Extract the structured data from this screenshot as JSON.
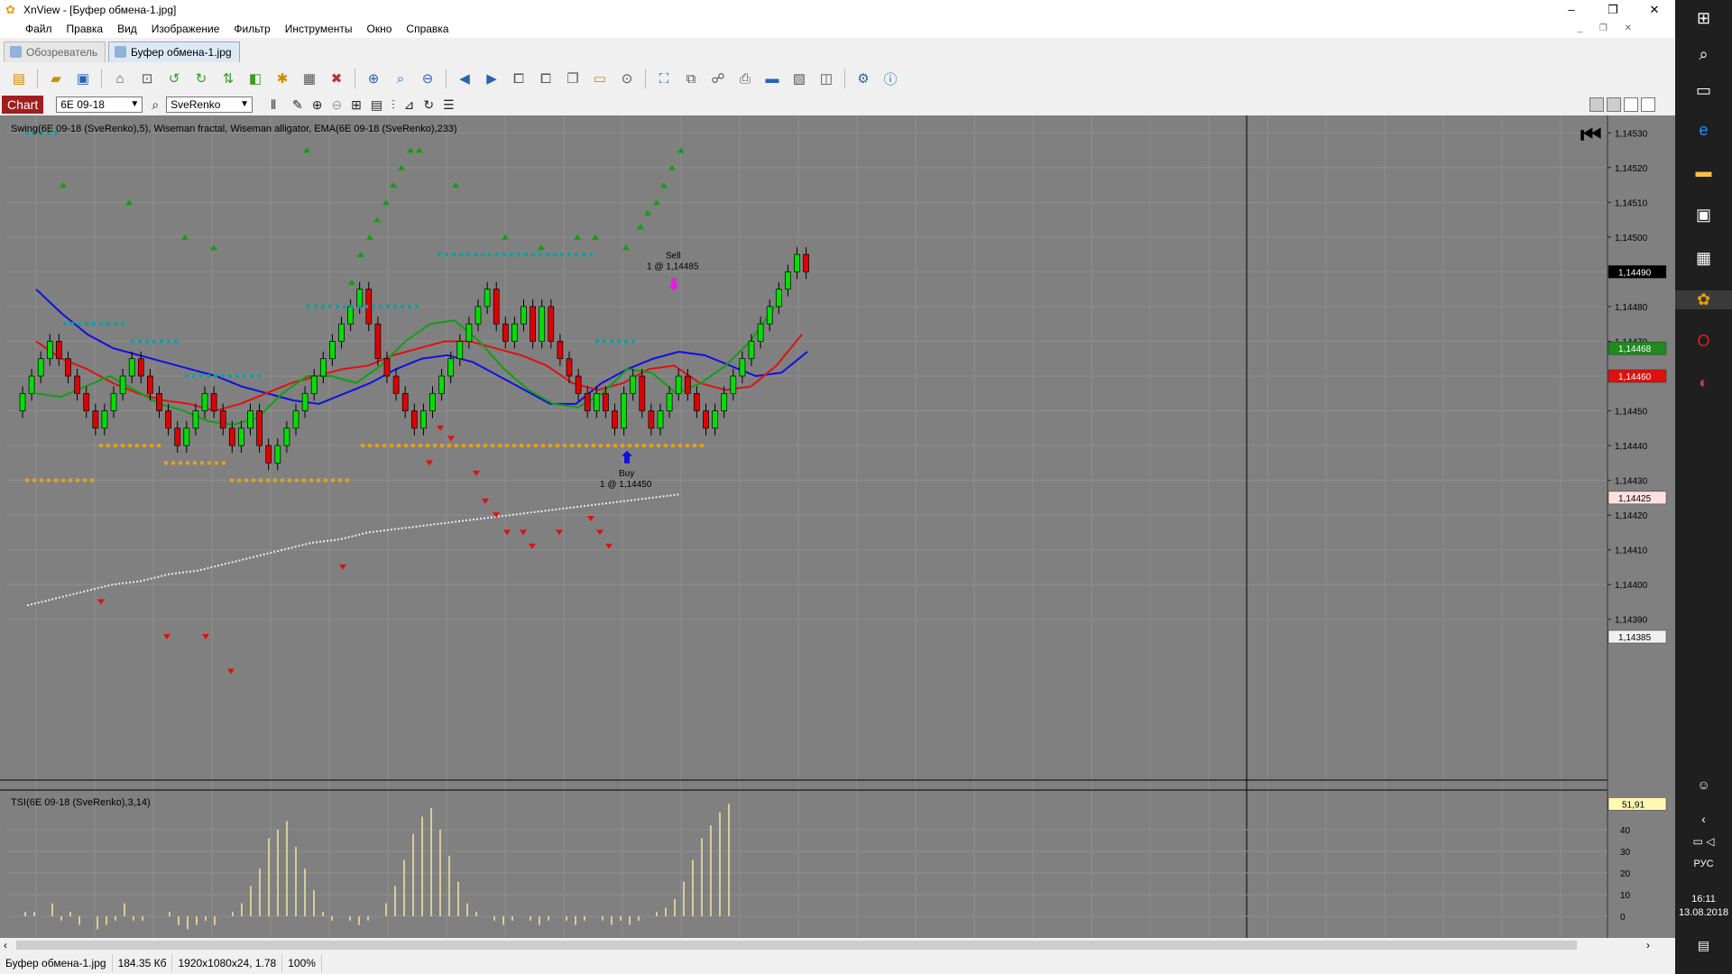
{
  "window": {
    "title": "XnView - [Буфер обмена-1.jpg]",
    "controls": [
      "–",
      "❐",
      "✕"
    ]
  },
  "menu": [
    "Файл",
    "Правка",
    "Вид",
    "Изображение",
    "Фильтр",
    "Инструменты",
    "Окно",
    "Справка"
  ],
  "tabs": [
    {
      "label": "Обозреватель",
      "active": false
    },
    {
      "label": "Буфер обмена-1.jpg",
      "active": true
    }
  ],
  "chart_toolbar": {
    "chart_label": "Chart",
    "instrument": "6E 09-18",
    "bar_type": "SveRenko"
  },
  "statusbar": {
    "filename": "Буфер обмена-1.jpg",
    "filesize": "184.35 Кб",
    "dimensions": "1920x1080x24, 1.78",
    "zoom": "100%"
  },
  "taskbar": {
    "language": "РУС",
    "time": "16:11",
    "date": "13.08.2018"
  },
  "chart_data": [
    {
      "type": "candlestick",
      "title": "Swing(6E 09-18 (SveRenko),5), Wiseman fractal, Wiseman alligator, EMA(6E 09-18 (SveRenko),233)",
      "ylim": [
        1.14385,
        1.14535
      ],
      "y_ticks": [
        "1,14530",
        "1,14520",
        "1,14510",
        "1,14500",
        "1,14490",
        "1,14480",
        "1,14470",
        "1,14460",
        "1,14450",
        "1,14440",
        "1,14430",
        "1,14420",
        "1,14410",
        "1,14400",
        "1,14390"
      ],
      "price_tags": [
        {
          "label": "1,14490",
          "value": 1.1449,
          "color": "#000000",
          "text_color": "#ffffff"
        },
        {
          "label": "1,14468",
          "value": 1.14468,
          "color": "#1e8c1e",
          "text_color": "#ffffff"
        },
        {
          "label": "1,14460",
          "value": 1.1446,
          "color": "#e01010",
          "text_color": "#ffffff"
        },
        {
          "label": "1,14425",
          "value": 1.14425,
          "color": "#ffe0e0",
          "text_color": "#000000"
        },
        {
          "label": "1,14385",
          "value": 1.14385,
          "color": "#f0f0f0",
          "text_color": "#000000"
        }
      ],
      "candles": [
        {
          "o": 1.1445,
          "c": 1.14455
        },
        {
          "o": 1.14455,
          "c": 1.1446
        },
        {
          "o": 1.1446,
          "c": 1.14465
        },
        {
          "o": 1.14465,
          "c": 1.1447
        },
        {
          "o": 1.1447,
          "c": 1.14465
        },
        {
          "o": 1.14465,
          "c": 1.1446
        },
        {
          "o": 1.1446,
          "c": 1.14455
        },
        {
          "o": 1.14455,
          "c": 1.1445
        },
        {
          "o": 1.1445,
          "c": 1.14445
        },
        {
          "o": 1.14445,
          "c": 1.1445
        },
        {
          "o": 1.1445,
          "c": 1.14455
        },
        {
          "o": 1.14455,
          "c": 1.1446
        },
        {
          "o": 1.1446,
          "c": 1.14465
        },
        {
          "o": 1.14465,
          "c": 1.1446
        },
        {
          "o": 1.1446,
          "c": 1.14455
        },
        {
          "o": 1.14455,
          "c": 1.1445
        },
        {
          "o": 1.1445,
          "c": 1.14445
        },
        {
          "o": 1.14445,
          "c": 1.1444
        },
        {
          "o": 1.1444,
          "c": 1.14445
        },
        {
          "o": 1.14445,
          "c": 1.1445
        },
        {
          "o": 1.1445,
          "c": 1.14455
        },
        {
          "o": 1.14455,
          "c": 1.1445
        },
        {
          "o": 1.1445,
          "c": 1.14445
        },
        {
          "o": 1.14445,
          "c": 1.1444
        },
        {
          "o": 1.1444,
          "c": 1.14445
        },
        {
          "o": 1.14445,
          "c": 1.1445
        },
        {
          "o": 1.1445,
          "c": 1.1444
        },
        {
          "o": 1.1444,
          "c": 1.14435
        },
        {
          "o": 1.14435,
          "c": 1.1444
        },
        {
          "o": 1.1444,
          "c": 1.14445
        },
        {
          "o": 1.14445,
          "c": 1.1445
        },
        {
          "o": 1.1445,
          "c": 1.14455
        },
        {
          "o": 1.14455,
          "c": 1.1446
        },
        {
          "o": 1.1446,
          "c": 1.14465
        },
        {
          "o": 1.14465,
          "c": 1.1447
        },
        {
          "o": 1.1447,
          "c": 1.14475
        },
        {
          "o": 1.14475,
          "c": 1.1448
        },
        {
          "o": 1.1448,
          "c": 1.14485
        },
        {
          "o": 1.14485,
          "c": 1.14475
        },
        {
          "o": 1.14475,
          "c": 1.14465
        },
        {
          "o": 1.14465,
          "c": 1.1446
        },
        {
          "o": 1.1446,
          "c": 1.14455
        },
        {
          "o": 1.14455,
          "c": 1.1445
        },
        {
          "o": 1.1445,
          "c": 1.14445
        },
        {
          "o": 1.14445,
          "c": 1.1445
        },
        {
          "o": 1.1445,
          "c": 1.14455
        },
        {
          "o": 1.14455,
          "c": 1.1446
        },
        {
          "o": 1.1446,
          "c": 1.14465
        },
        {
          "o": 1.14465,
          "c": 1.1447
        },
        {
          "o": 1.1447,
          "c": 1.14475
        },
        {
          "o": 1.14475,
          "c": 1.1448
        },
        {
          "o": 1.1448,
          "c": 1.14485
        },
        {
          "o": 1.14485,
          "c": 1.14475
        },
        {
          "o": 1.14475,
          "c": 1.1447
        },
        {
          "o": 1.1447,
          "c": 1.14475
        },
        {
          "o": 1.14475,
          "c": 1.1448
        },
        {
          "o": 1.1448,
          "c": 1.1447
        },
        {
          "o": 1.1447,
          "c": 1.1448
        },
        {
          "o": 1.1448,
          "c": 1.1447
        },
        {
          "o": 1.1447,
          "c": 1.14465
        },
        {
          "o": 1.14465,
          "c": 1.1446
        },
        {
          "o": 1.1446,
          "c": 1.14455
        },
        {
          "o": 1.14455,
          "c": 1.1445
        },
        {
          "o": 1.1445,
          "c": 1.14455
        },
        {
          "o": 1.14455,
          "c": 1.1445
        },
        {
          "o": 1.1445,
          "c": 1.14445
        },
        {
          "o": 1.14445,
          "c": 1.14455
        },
        {
          "o": 1.14455,
          "c": 1.1446
        },
        {
          "o": 1.1446,
          "c": 1.1445
        },
        {
          "o": 1.1445,
          "c": 1.14445
        },
        {
          "o": 1.14445,
          "c": 1.1445
        },
        {
          "o": 1.1445,
          "c": 1.14455
        },
        {
          "o": 1.14455,
          "c": 1.1446
        },
        {
          "o": 1.1446,
          "c": 1.14455
        },
        {
          "o": 1.14455,
          "c": 1.1445
        },
        {
          "o": 1.1445,
          "c": 1.14445
        },
        {
          "o": 1.14445,
          "c": 1.1445
        },
        {
          "o": 1.1445,
          "c": 1.14455
        },
        {
          "o": 1.14455,
          "c": 1.1446
        },
        {
          "o": 1.1446,
          "c": 1.14465
        },
        {
          "o": 1.14465,
          "c": 1.1447
        },
        {
          "o": 1.1447,
          "c": 1.14475
        },
        {
          "o": 1.14475,
          "c": 1.1448
        },
        {
          "o": 1.1448,
          "c": 1.14485
        },
        {
          "o": 1.14485,
          "c": 1.1449
        },
        {
          "o": 1.1449,
          "c": 1.14495
        },
        {
          "o": 1.14495,
          "c": 1.1449
        }
      ],
      "alligator_blue": [
        1.14485,
        1.14478,
        1.14472,
        1.14468,
        1.14466,
        1.14464,
        1.14462,
        1.1446,
        1.14457,
        1.14455,
        1.14453,
        1.14452,
        1.14455,
        1.14458,
        1.14462,
        1.14465,
        1.14466,
        1.14464,
        1.1446,
        1.14456,
        1.14452,
        1.14452,
        1.14458,
        1.14462,
        1.14465,
        1.14467,
        1.14466,
        1.14463,
        1.1446,
        1.14461,
        1.14467
      ],
      "alligator_red": [
        1.1447,
        1.14465,
        1.14462,
        1.14458,
        1.14455,
        1.14453,
        1.14452,
        1.1445,
        1.14452,
        1.14455,
        1.14458,
        1.1446,
        1.14462,
        1.14463,
        1.14466,
        1.14468,
        1.1447,
        1.1447,
        1.14468,
        1.14466,
        1.14463,
        1.14458,
        1.14456,
        1.14458,
        1.14462,
        1.14463,
        1.14458,
        1.14456,
        1.14457,
        1.14463,
        1.14472
      ],
      "alligator_green": [
        1.14455,
        1.14454,
        1.14457,
        1.1446,
        1.14456,
        1.14452,
        1.1445,
        1.14447,
        1.14446,
        1.14448,
        1.14455,
        1.1446,
        1.1446,
        1.14458,
        1.14463,
        1.1447,
        1.14475,
        1.14476,
        1.1447,
        1.14462,
        1.14456,
        1.14452,
        1.14451,
        1.14455,
        1.14462,
        1.14461,
        1.14455,
        1.14458,
        1.14463,
        1.1447,
        1.1448
      ],
      "ema_233": [
        1.14394,
        1.14396,
        1.14398,
        1.144,
        1.14401,
        1.14403,
        1.14404,
        1.14406,
        1.14408,
        1.1441,
        1.14412,
        1.14413,
        1.14415,
        1.14416,
        1.14417,
        1.14418,
        1.14419,
        1.1442,
        1.14421,
        1.14422,
        1.14423,
        1.14424,
        1.14425,
        1.14426
      ],
      "trades": [
        {
          "side": "Sell",
          "label": "Sell",
          "qty_price": "1 @ 1,14485"
        },
        {
          "side": "Buy",
          "label": "Buy",
          "qty_price": "1 @ 1,14450"
        }
      ]
    },
    {
      "type": "bar",
      "title": "TSI(6E 09-18 (SveRenko),3,14)",
      "current_value": "51,91",
      "y_ticks": [
        "40",
        "30",
        "20",
        "10",
        "0"
      ],
      "values": [
        2,
        2,
        0,
        6,
        -2,
        2,
        -4,
        0,
        -6,
        -4,
        -2,
        6,
        -2,
        -2,
        0,
        0,
        2,
        -4,
        -6,
        -4,
        -2,
        -4,
        0,
        2,
        6,
        14,
        22,
        36,
        40,
        44,
        32,
        22,
        12,
        2,
        -2,
        0,
        -2,
        -4,
        -2,
        0,
        6,
        14,
        26,
        38,
        46,
        50,
        40,
        28,
        16,
        6,
        2,
        0,
        -2,
        -4,
        -2,
        0,
        -2,
        -4,
        -2,
        0,
        -2,
        -4,
        -2,
        0,
        -2,
        -4,
        -2,
        -4,
        -2,
        0,
        2,
        4,
        8,
        16,
        26,
        36,
        42,
        48,
        52
      ]
    }
  ]
}
